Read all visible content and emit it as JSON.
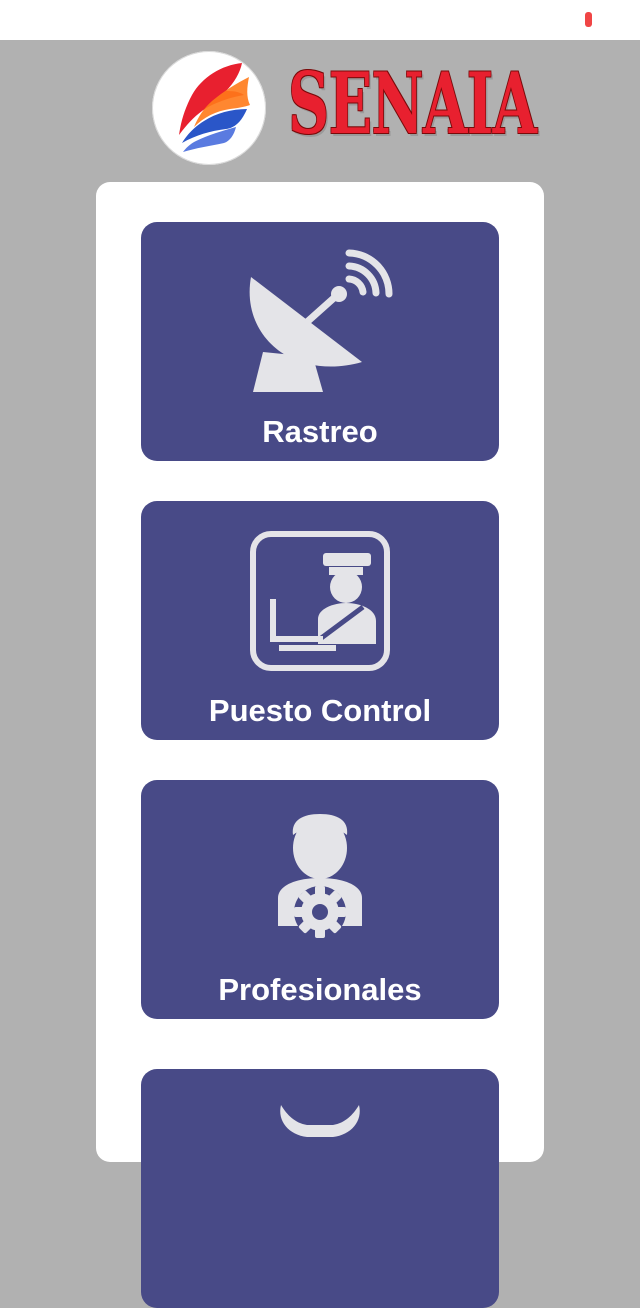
{
  "colors": {
    "background": "#b1b1b1",
    "panel": "#ffffff",
    "card": "#484a87",
    "icon_fill": "#e4e4e8",
    "brand_red": "#e8202f",
    "status_indicator": "#f04545"
  },
  "header": {
    "brand_name": "SENAIA",
    "logo_icon": "senaia-flame-logo"
  },
  "menu": {
    "items": [
      {
        "label": "Rastreo",
        "icon": "satellite-dish-icon"
      },
      {
        "label": "Puesto Control",
        "icon": "guard-checkpoint-icon"
      },
      {
        "label": "Profesionales",
        "icon": "professional-gear-icon"
      },
      {
        "label": "",
        "icon": "partial-icon"
      }
    ]
  }
}
